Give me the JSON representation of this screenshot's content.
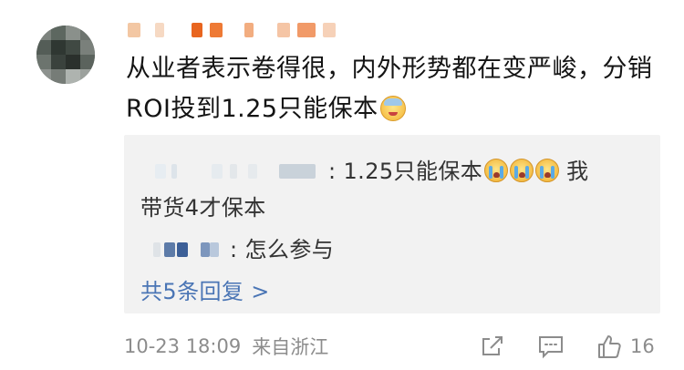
{
  "comment": {
    "avatar_alt": "avatar",
    "text": "从业者表示卷得很，内外形势都在变严峻，分销ROI投到1.25只能保本",
    "emoji": "sick-face-emoji"
  },
  "replies": {
    "reply1_text_a": ": 1.25只能保本",
    "reply1_text_b": " 我",
    "reply1_text_c": "带货4才保本",
    "reply1_emoji": "crying-face-emoji",
    "reply2_text": ": 怎么参与",
    "more_label": "共5条回复 >"
  },
  "footer": {
    "time": "10-23 18:09",
    "location": "来自浙江",
    "like_count": "16"
  },
  "icons": {
    "share": "share-icon",
    "comment": "comment-icon",
    "like": "thumbs-up-icon"
  }
}
